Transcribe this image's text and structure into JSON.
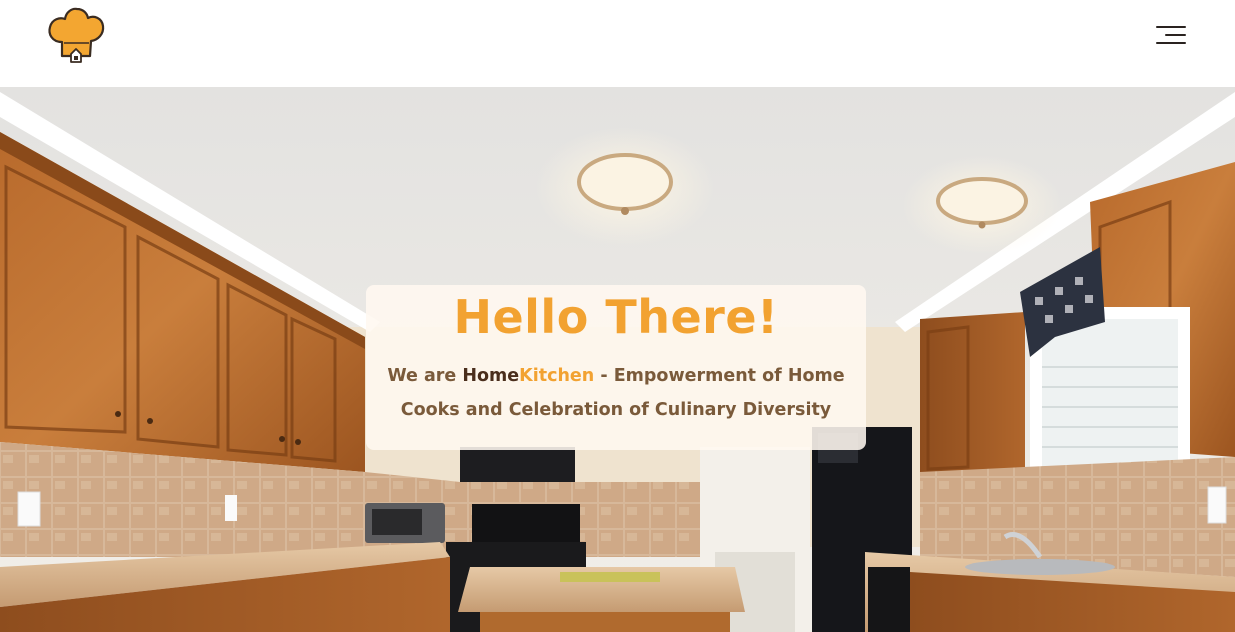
{
  "header": {
    "logo_icon": "chef-hat-house-icon",
    "menu_icon": "hamburger-menu-icon"
  },
  "hero": {
    "title": "Hello There!",
    "intro_prefix": "We are ",
    "brand_part1": "Home",
    "brand_part2": "Kitchen",
    "intro_suffix": " - Empowerment of Home Cooks and Celebration of Culinary Diversity"
  },
  "colors": {
    "accent": "#f2a231",
    "brand_dark": "#4a2e1c",
    "text_brown": "#7a5a3a"
  }
}
